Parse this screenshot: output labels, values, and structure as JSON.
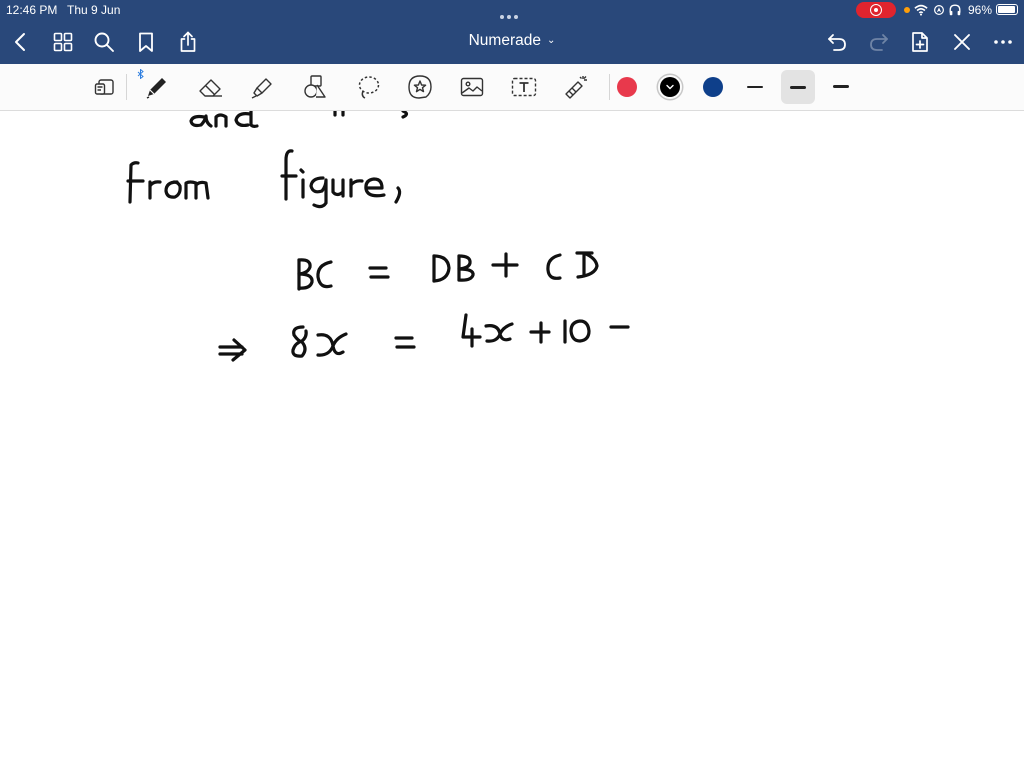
{
  "status_bar": {
    "time": "12:46 PM",
    "date": "Thu 9 Jun",
    "battery": "96%",
    "icons": [
      "screen-record-icon",
      "wifi-icon",
      "location-icon",
      "headphones-icon",
      "battery-icon"
    ]
  },
  "nav": {
    "title": "Numerade",
    "left_icons": [
      "back-icon",
      "grid-icon",
      "search-icon",
      "bookmark-icon",
      "share-icon"
    ],
    "right_icons": [
      "undo-icon",
      "redo-icon",
      "add-page-icon",
      "close-icon",
      "more-icon"
    ]
  },
  "toolbar": {
    "tools": [
      "read-mode-icon",
      "pen-icon",
      "eraser-icon",
      "highlighter-icon",
      "shapes-icon",
      "lasso-icon",
      "sticker-icon",
      "image-icon",
      "text-box-icon",
      "laser-pointer-icon"
    ],
    "colors": [
      "#e8394c",
      "#000000",
      "#0e3f8a"
    ],
    "selected_color": "#000000",
    "stroke_widths": [
      "thin",
      "medium",
      "thick"
    ],
    "selected_stroke": "medium"
  },
  "canvas": {
    "handwriting_lines": [
      "and",
      "from figure,",
      "BC = DB + CD",
      "⇒ 8x = 4x + 10 −"
    ]
  },
  "colors": {
    "bar": "#29487a",
    "toolbar": "#fbfbfb",
    "ink": "#111111"
  }
}
